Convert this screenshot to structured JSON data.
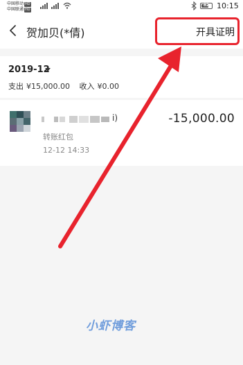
{
  "status_bar": {
    "carrier1": "中国移动",
    "carrier2": "中国联通",
    "network_badge": "HD",
    "battery": "82",
    "time": "10:15"
  },
  "nav": {
    "title": "贺加贝(*倩)",
    "action": "开具证明"
  },
  "summary": {
    "month": "2019-12",
    "expense_label": "支出",
    "expense_value": "¥15,000.00",
    "income_label": "收入",
    "income_value": "¥0.00"
  },
  "transaction": {
    "name_suffix": "i)",
    "amount": "-15,000.00",
    "type": "转账红包",
    "time": "12-12  14:33"
  },
  "watermark": "小虾博客",
  "colors": {
    "highlight": "#e8232d",
    "watermark": "#5b8fd8"
  }
}
